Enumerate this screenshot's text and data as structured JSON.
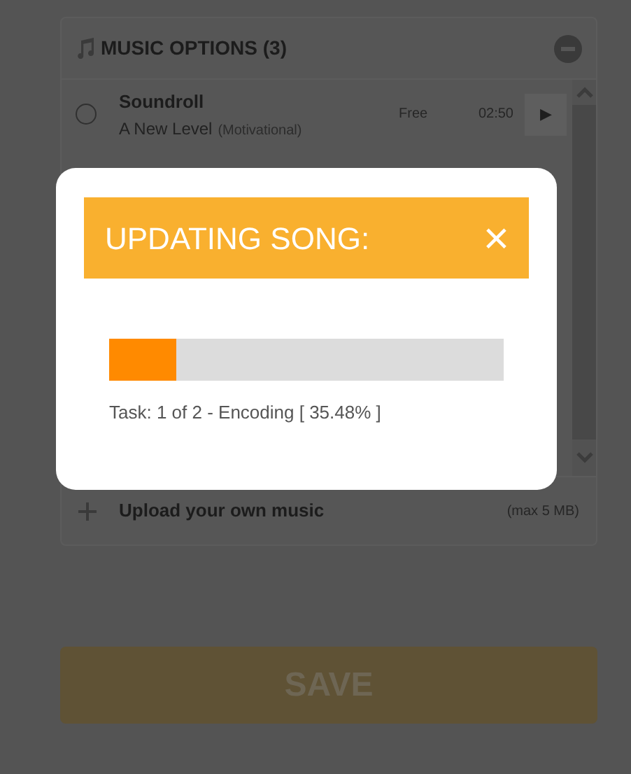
{
  "music_options": {
    "title": "MUSIC OPTIONS (3)",
    "songs": [
      {
        "artist": "Soundroll",
        "title": "A New Level",
        "genre": "(Motivational)",
        "price": "Free",
        "duration": "02:50",
        "play": "▶",
        "selected": false
      }
    ],
    "upload": {
      "label": "Upload your own music",
      "limit": "(max 5 MB)"
    }
  },
  "save_button": "SAVE",
  "modal": {
    "title": "UPDATING SONG:",
    "close": "×",
    "progress": {
      "level": 0.17
    },
    "status": "Task: 1 of 2 - Encoding [ 35.48% ]"
  }
}
